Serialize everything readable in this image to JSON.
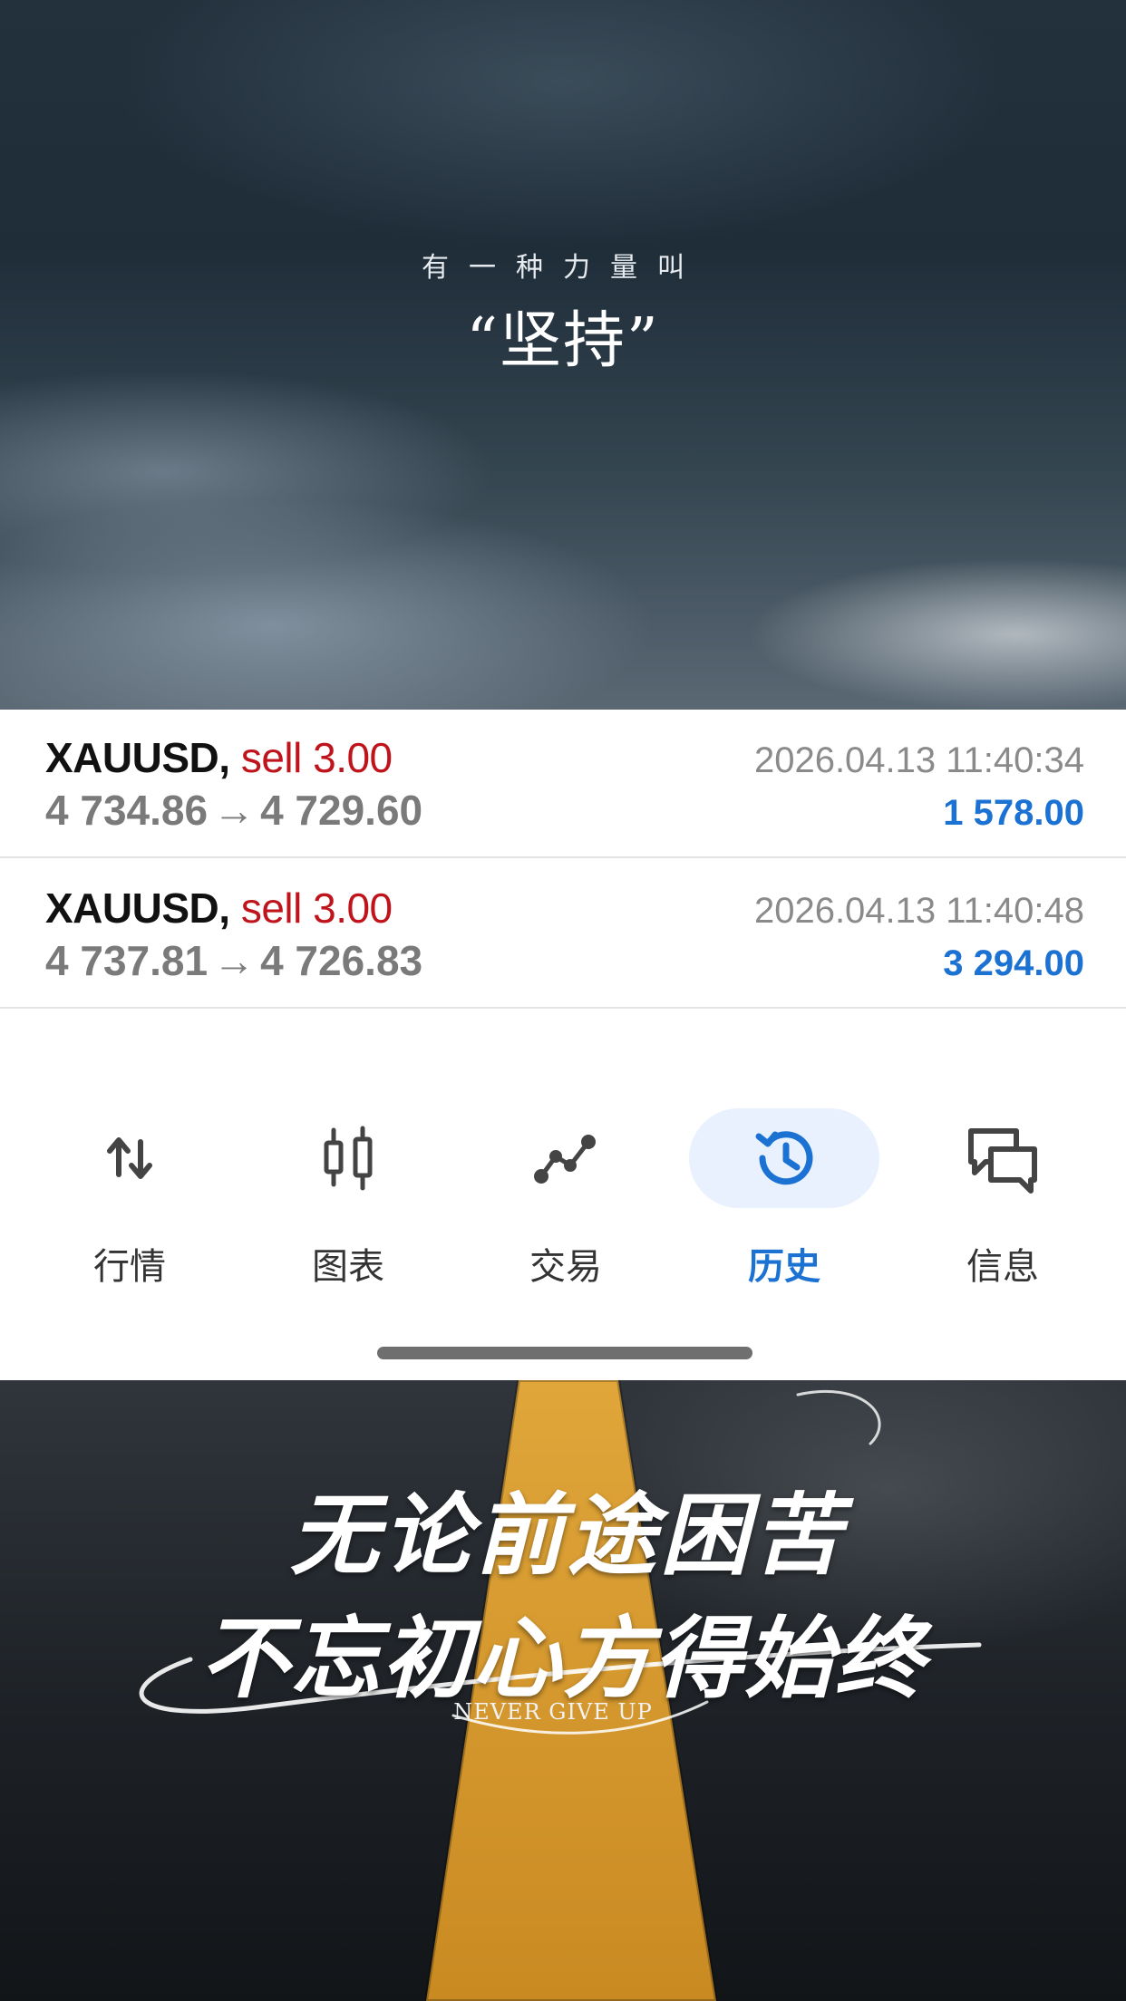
{
  "top_banner": {
    "line1": "有一种力量叫",
    "line2": "“坚持”"
  },
  "history": [
    {
      "symbol": "XAUUSD",
      "separator": ",",
      "side": "sell 3.00",
      "datetime": "2026.04.13 11:40:34",
      "open_price": "4 734.86",
      "arrow": "→",
      "close_price": "4 729.60",
      "profit": "1 578.00"
    },
    {
      "symbol": "XAUUSD",
      "separator": ",",
      "side": "sell 3.00",
      "datetime": "2026.04.13 11:40:48",
      "open_price": "4 737.81",
      "arrow": "→",
      "close_price": "4 726.83",
      "profit": "3 294.00"
    }
  ],
  "nav": {
    "active": "history",
    "items": [
      {
        "id": "quotes",
        "label": "行情",
        "icon": "arrows-updown-icon"
      },
      {
        "id": "chart",
        "label": "图表",
        "icon": "candlestick-icon"
      },
      {
        "id": "trade",
        "label": "交易",
        "icon": "trend-line-icon"
      },
      {
        "id": "history",
        "label": "历史",
        "icon": "history-clock-icon"
      },
      {
        "id": "messages",
        "label": "信息",
        "icon": "chat-bubbles-icon"
      }
    ]
  },
  "bottom_banner": {
    "title_line1": "无论前途困苦",
    "title_line2": "不忘初心方得始终",
    "subtitle": "NEVER GIVE UP"
  },
  "colors": {
    "sell": "#c0141c",
    "profit": "#1c72d2",
    "active_nav": "#1c72d2",
    "active_nav_bg": "#e8f1fd",
    "road_stripe": "#d99a2b"
  }
}
